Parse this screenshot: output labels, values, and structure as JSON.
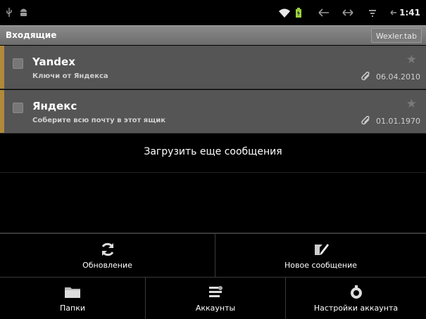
{
  "status_bar": {
    "time": "1:41",
    "icons": [
      "usb-icon",
      "android-icon",
      "wifi-icon",
      "battery-icon",
      "back-arrow-icon",
      "sync-icon",
      "signal-icon",
      "back-icon"
    ]
  },
  "header": {
    "title": "Входящие",
    "account": "Wexler.tab"
  },
  "messages": [
    {
      "sender": "Yandex",
      "subject": "Ключи от Яндекса",
      "date": "06.04.2010",
      "has_attachment": true,
      "starred": false
    },
    {
      "sender": "Яндекс",
      "subject": "Соберите всю почту в этот ящик",
      "date": "01.01.1970",
      "has_attachment": true,
      "starred": false
    }
  ],
  "load_more": "Загрузить еще сообщения",
  "menu": {
    "row1": [
      {
        "label": "Обновление",
        "icon": "refresh-icon"
      },
      {
        "label": "Новое сообщение",
        "icon": "compose-icon"
      }
    ],
    "row2": [
      {
        "label": "Папки",
        "icon": "folder-icon"
      },
      {
        "label": "Аккаунты",
        "icon": "accounts-icon"
      },
      {
        "label": "Настройки аккаунта",
        "icon": "settings-icon"
      }
    ]
  },
  "colors": {
    "accent": "#b0893a",
    "message_bg": "#555555",
    "titlebar": "#7a7a7a",
    "background": "#000000"
  }
}
